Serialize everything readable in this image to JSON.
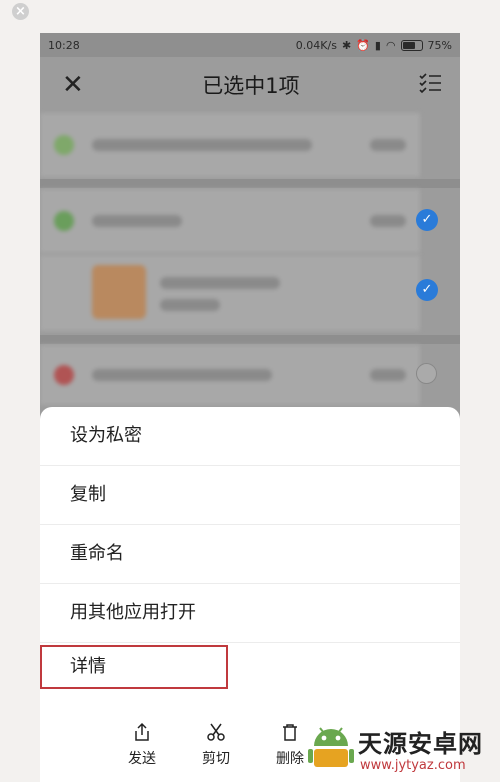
{
  "status_bar": {
    "time": "10:28",
    "speed": "0.04K/s",
    "battery": "75%",
    "battery_level": 0.75
  },
  "appbar": {
    "title": "已选中1项"
  },
  "sheet_menu": {
    "items": [
      "设为私密",
      "复制",
      "重命名",
      "用其他应用打开",
      "详情"
    ]
  },
  "toolbar": {
    "send": "发送",
    "cut": "剪切",
    "delete": "删除"
  },
  "watermark": {
    "name": "天源安卓网",
    "url": "www.jytyaz.com"
  },
  "colors": {
    "accent": "#2a7bd9",
    "highlight": "#c0393d"
  }
}
